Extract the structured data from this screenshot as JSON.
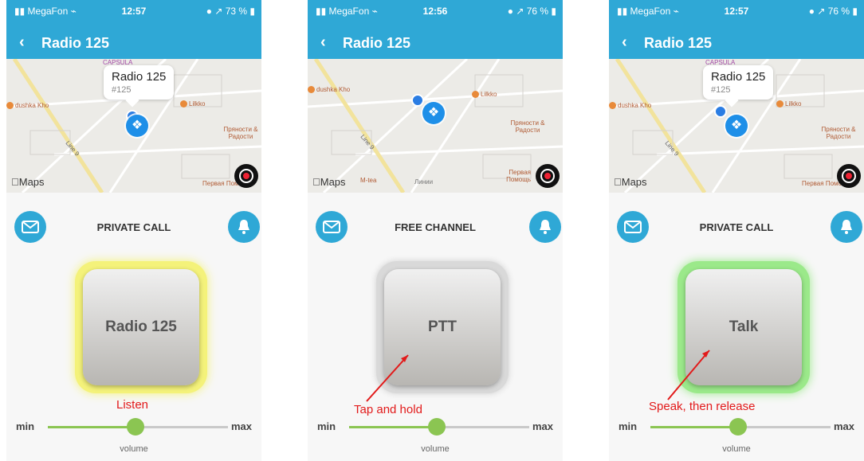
{
  "screens": [
    {
      "status": {
        "carrier": "▮▮ MegaFon ⌁",
        "time": "12:57",
        "battery": "● ↗ 73 % ▮"
      },
      "nav": {
        "back_icon": "‹",
        "title": "Radio 125"
      },
      "map": {
        "maps_label": "Maps",
        "callout": {
          "title": "Radio 125",
          "subtitle": "#125"
        },
        "labels": {
          "capsula": "CAPSULA",
          "dushka": "dushka Kho",
          "lilkko": "Lilkko",
          "pryanosti": "Пряности & Радости",
          "line9": "Line 9",
          "pervaya": "Первая Помощь"
        }
      },
      "mode": "PRIVATE CALL",
      "ptt_label": "Radio 125",
      "ptt_glow": "#f4f27a",
      "annotation": "Listen",
      "slider": {
        "min": "min",
        "max": "max",
        "label": "volume",
        "value": 0.5
      }
    },
    {
      "status": {
        "carrier": "▮▮ MegaFon ⌁",
        "time": "12:56",
        "battery": "● ↗ 76 % ▮"
      },
      "nav": {
        "back_icon": "‹",
        "title": "Radio 125"
      },
      "map": {
        "maps_label": "Maps",
        "labels": {
          "dushka": "dushka Kho",
          "lilkko": "Lilkko",
          "pryanosti": "Пряности & Радости",
          "line9": "Line 9",
          "mtea": "M-tea",
          "linii": "Линии",
          "pervaya": "Первая Помощь"
        }
      },
      "mode": "FREE CHANNEL",
      "ptt_label": "PTT",
      "ptt_glow": "#d9d9d9",
      "annotation": "Tap and hold",
      "slider": {
        "min": "min",
        "max": "max",
        "label": "volume",
        "value": 0.5
      }
    },
    {
      "status": {
        "carrier": "▮▮ MegaFon ⌁",
        "time": "12:57",
        "battery": "● ↗ 76 % ▮"
      },
      "nav": {
        "back_icon": "‹",
        "title": "Radio 125"
      },
      "map": {
        "maps_label": "Maps",
        "callout": {
          "title": "Radio 125",
          "subtitle": "#125"
        },
        "labels": {
          "capsula": "CAPSULA",
          "dushka": "dushka Kho",
          "lilkko": "Lilkko",
          "pryanosti": "Пряности & Радости",
          "line9": "Line 9",
          "pervaya": "Первая Помощь"
        }
      },
      "mode": "PRIVATE CALL",
      "ptt_label": "Talk",
      "ptt_glow": "#9be98a",
      "annotation": "Speak, then release",
      "slider": {
        "min": "min",
        "max": "max",
        "label": "volume",
        "value": 0.5
      }
    }
  ]
}
